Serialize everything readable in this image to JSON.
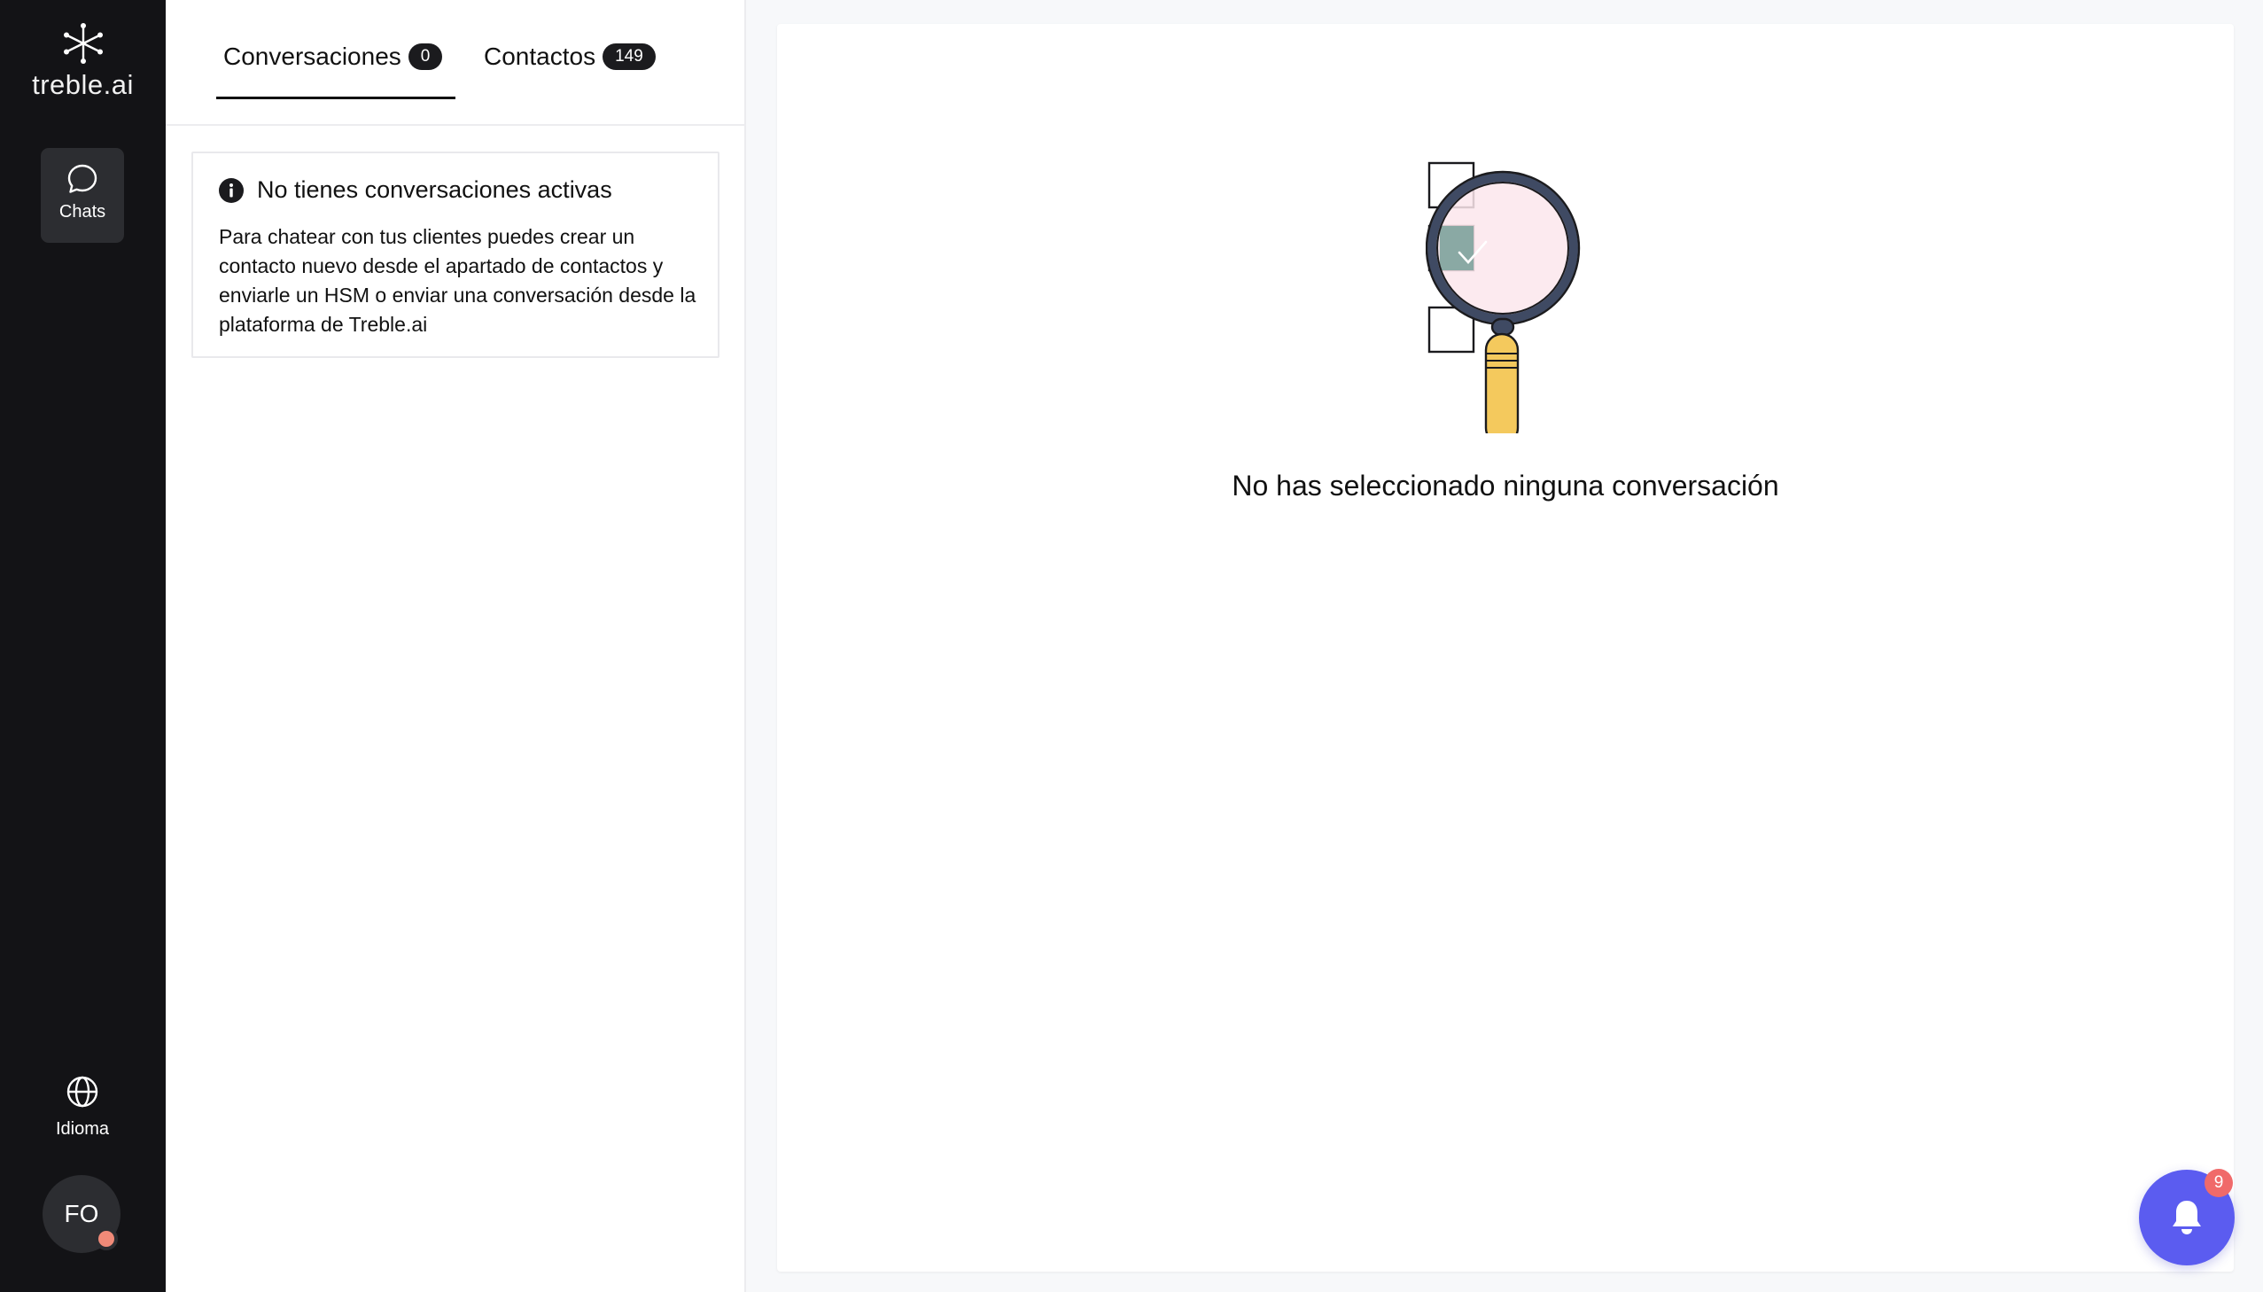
{
  "brand": {
    "name": "treble.ai",
    "icon": "treble-logo-icon"
  },
  "rail": {
    "chats": {
      "label": "Chats",
      "icon": "chat-bubble-icon"
    },
    "language": {
      "label": "Idioma",
      "icon": "globe-icon"
    },
    "user": {
      "initials": "FO",
      "status_color": "#f08a78"
    }
  },
  "tabs": [
    {
      "label": "Conversaciones",
      "count": "0",
      "active": true
    },
    {
      "label": "Contactos",
      "count": "149",
      "active": false
    }
  ],
  "info_card": {
    "icon": "info-icon",
    "title": "No tienes conversaciones activas",
    "body": "Para chatear con tus clientes puedes crear un contacto nuevo desde el apartado de contactos y enviarle un HSM o enviar una conversación desde la plataforma de Treble.ai"
  },
  "main": {
    "illustration": "magnifier-checklist-icon",
    "empty_message": "No has seleccionado ninguna conversación"
  },
  "notifications": {
    "icon": "bell-icon",
    "count": "9",
    "color": "#5b5cf0"
  },
  "colors": {
    "rail_bg": "#131316",
    "active_item_bg": "#2c2d31",
    "accent": "#5b5cf0",
    "badge": "#f06a6a"
  }
}
